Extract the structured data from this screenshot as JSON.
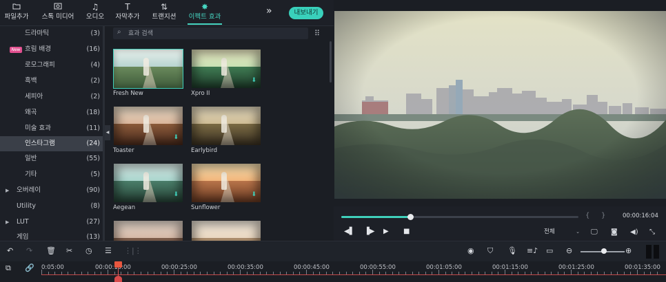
{
  "toolbar": {
    "tabs": [
      {
        "label": "파일추가",
        "icon": "folder-icon"
      },
      {
        "label": "스톡 미디어",
        "icon": "stock-media-icon"
      },
      {
        "label": "오디오",
        "icon": "music-note-icon"
      },
      {
        "label": "자막추가",
        "icon": "text-icon"
      },
      {
        "label": "트랜지션",
        "icon": "transition-icon"
      },
      {
        "label": "이펙트 효과",
        "icon": "effects-icon"
      }
    ],
    "active_tab": "이펙트 효과",
    "more_icon": "double-chevron-right-icon",
    "export_label": "내보내기",
    "accent_color": "#3fd0bb"
  },
  "sidebar": {
    "categories": [
      {
        "name": "드라마틱",
        "count": "(3)"
      },
      {
        "name": "흐림 배경",
        "count": "(16)",
        "badge": "New"
      },
      {
        "name": "로모그래피",
        "count": "(4)"
      },
      {
        "name": "흑백",
        "count": "(2)"
      },
      {
        "name": "세피아",
        "count": "(2)"
      },
      {
        "name": "왜곡",
        "count": "(18)"
      },
      {
        "name": "미술 효과",
        "count": "(11)"
      },
      {
        "name": "인스타그램",
        "count": "(24)",
        "selected": true
      },
      {
        "name": "일반",
        "count": "(55)"
      },
      {
        "name": "기타",
        "count": "(5)"
      },
      {
        "name": "오버레이",
        "count": "(90)",
        "expandable": true
      },
      {
        "name": "Utility",
        "count": "(8)"
      },
      {
        "name": "LUT",
        "count": "(27)",
        "expandable": true
      },
      {
        "name": "게임",
        "count": "(13)"
      }
    ],
    "collapse_icon": "collapse-left-icon"
  },
  "effects": {
    "search_placeholder": "효과 검색",
    "items": [
      {
        "name": "Fresh New",
        "selected": true
      },
      {
        "name": "Xpro II",
        "download": true
      },
      {
        "name": "Toaster",
        "download": true
      },
      {
        "name": "Earlybird"
      },
      {
        "name": "Aegean",
        "download": true
      },
      {
        "name": "Sunflower",
        "download": true
      },
      {
        "name": ""
      },
      {
        "name": ""
      }
    ]
  },
  "preview": {
    "timecode": "00:00:16:04",
    "progress": 0.29,
    "resolution_option": "전체",
    "controls": [
      "step-back-icon",
      "step-forward-icon",
      "play-icon",
      "stop-icon"
    ],
    "right_icons": [
      "monitor-icon",
      "camera-icon",
      "volume-icon",
      "fullscreen-icon"
    ]
  },
  "timeline": {
    "tools": [
      "undo-icon",
      "redo-icon",
      "delete-icon",
      "cut-icon",
      "speed-icon",
      "adjust-icon",
      "audio-waveform-icon"
    ],
    "right_tools": [
      "render-icon",
      "marker-icon",
      "mic-icon",
      "voiceover-icon",
      "caption-icon",
      "zoom-out-icon",
      "zoom-in-icon"
    ],
    "zoom_level": 0.5,
    "ruler_labels": [
      "0:05:00",
      "00:00:15:00",
      "00:00:25:00",
      "00:00:35:00",
      "00:00:45:00",
      "00:00:55:00",
      "00:01:05:00",
      "00:01:15:00",
      "00:01:25:00",
      "00:01:35:00"
    ]
  }
}
